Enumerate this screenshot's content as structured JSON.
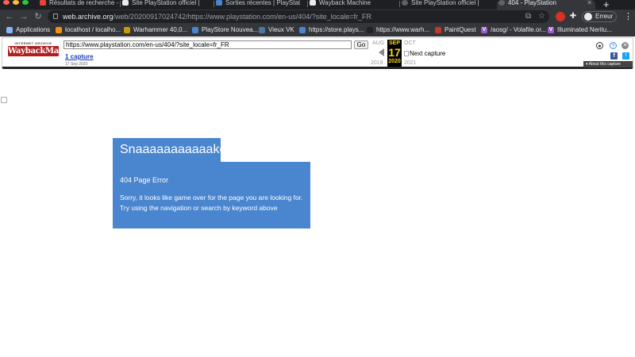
{
  "browser": {
    "tabs": [
      {
        "label": "Résultats de recherche - [",
        "icon": "gmail-icon",
        "active": false
      },
      {
        "label": "Site PlayStation officiel | ",
        "icon": "playstation-icon",
        "active": false
      },
      {
        "label": "Sorties récentes | PlayStat",
        "icon": "playstation-icon",
        "active": false
      },
      {
        "label": "Wayback Machine",
        "icon": "wayback-icon",
        "active": false
      },
      {
        "label": "Site PlayStation officiel | ",
        "icon": "globe-icon",
        "active": false
      },
      {
        "label": "404 - PlayStation",
        "icon": "globe-icon",
        "active": true
      }
    ],
    "new_tab": "+",
    "address": {
      "domain": "web.archive.org",
      "path": "/web/20200917024742/https://www.playstation.com/en-us/404/?site_locale=fr_FR"
    },
    "profile_label": "Erreur",
    "bookmarks": [
      {
        "label": "Applications",
        "icon": "apps-grid-icon",
        "color": "#8ab4f8"
      },
      {
        "label": "localhost / localho...",
        "icon": "phpmyadmin-icon",
        "color": "#f29111"
      },
      {
        "label": "Warhammer 40,0...",
        "icon": "warhammer-icon",
        "color": "#c79a00"
      },
      {
        "label": "PlayStore Nouvea...",
        "icon": "playstore-icon",
        "color": "#4a85cf"
      },
      {
        "label": "Vieux VK",
        "icon": "vk-icon",
        "color": "#4c75a3"
      },
      {
        "label": "https://store.plays...",
        "icon": "playstation-icon",
        "color": "#4a85cf"
      },
      {
        "label": "https://www.warh...",
        "icon": "warhammer-icon",
        "color": "#222222"
      },
      {
        "label": "PaintQuest",
        "icon": "paintquest-icon",
        "color": "#c0392b"
      },
      {
        "label": "/aosg/ - Volafile.or...",
        "icon": "volafile-icon",
        "color": "#9b59d0"
      },
      {
        "label": "Illuminated Neritu...",
        "icon": "volafile-icon",
        "color": "#9b59d0"
      }
    ]
  },
  "wayback": {
    "logo_top": "INTERNET ARCHIVE",
    "logo": "WaybackMachine",
    "url_value": "https://www.playstation.com/en-us/404/?site_locale=fr_FR",
    "go_label": "Go",
    "captures_label": "1 capture",
    "capture_date": "17 Sep 2020",
    "prev_month": "AUG",
    "next_month": "OCT",
    "prev_year": "2019",
    "next_year": "2021",
    "current_month": "SEP",
    "current_day": "17",
    "current_year": "2020",
    "next_capture": "Next capture",
    "about_label": "About this capture",
    "facebook": "f",
    "twitter": "t"
  },
  "page": {
    "title": "Snaaaaaaaaaaake",
    "error_heading": "404 Page Error",
    "error_message": "Sorry, it looks like game over for the page you are looking for. Try using the navigation or search by keyword above"
  }
}
